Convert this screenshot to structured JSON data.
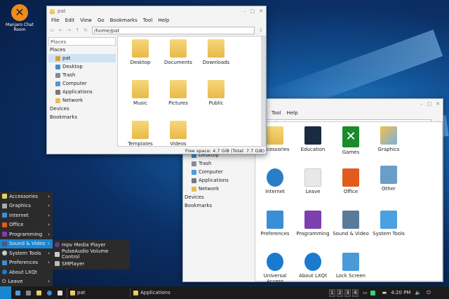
{
  "desktop": {
    "icon_label": "Manjaro Chat Room"
  },
  "window1": {
    "title": "pat",
    "menus": [
      "File",
      "Edit",
      "View",
      "Go",
      "Bookmarks",
      "Tool",
      "Help"
    ],
    "path": "/home/pat",
    "side_combo": "Places",
    "side_header": "Places",
    "places": [
      "pat",
      "Desktop",
      "Trash",
      "Computer",
      "Applications",
      "Network"
    ],
    "devices": "Devices",
    "bookmarks": "Bookmarks",
    "items": [
      "Desktop",
      "Documents",
      "Downloads",
      "Music",
      "Pictures",
      "Public",
      "Templates",
      "Videos"
    ],
    "status": "Free space: 4.7 GiB (Total: 7.7 GiB)"
  },
  "window2": {
    "menus": [
      "Tool",
      "Help"
    ],
    "path": "pplications/",
    "places": [
      "Desktop",
      "Trash",
      "Computer",
      "Applications",
      "Network"
    ],
    "devices": "Devices",
    "bookmarks": "Bookmarks",
    "items": [
      "Accessories",
      "Education",
      "Games",
      "Graphics",
      "Internet",
      "Leave",
      "Office",
      "Other",
      "Preferences",
      "Programming",
      "Sound & Video",
      "System Tools",
      "Universal Access",
      "About LXQt",
      "Lock Screen"
    ]
  },
  "menu": {
    "items": [
      "Accessories",
      "Graphics",
      "Internet",
      "Office",
      "Programming",
      "Sound & Video",
      "System Tools",
      "Preferences",
      "About LXQt",
      "Leave"
    ],
    "submenu": [
      "mpv Media Player",
      "PulseAudio Volume Control",
      "SMPlayer"
    ]
  },
  "taskbar": {
    "tasks": [
      "pat",
      "Applications"
    ],
    "workspaces": [
      "1",
      "2",
      "3",
      "4"
    ],
    "clock": "4:20 PM"
  },
  "colors": {
    "accent": "#1a86d0",
    "logo": "#f08a1c"
  }
}
